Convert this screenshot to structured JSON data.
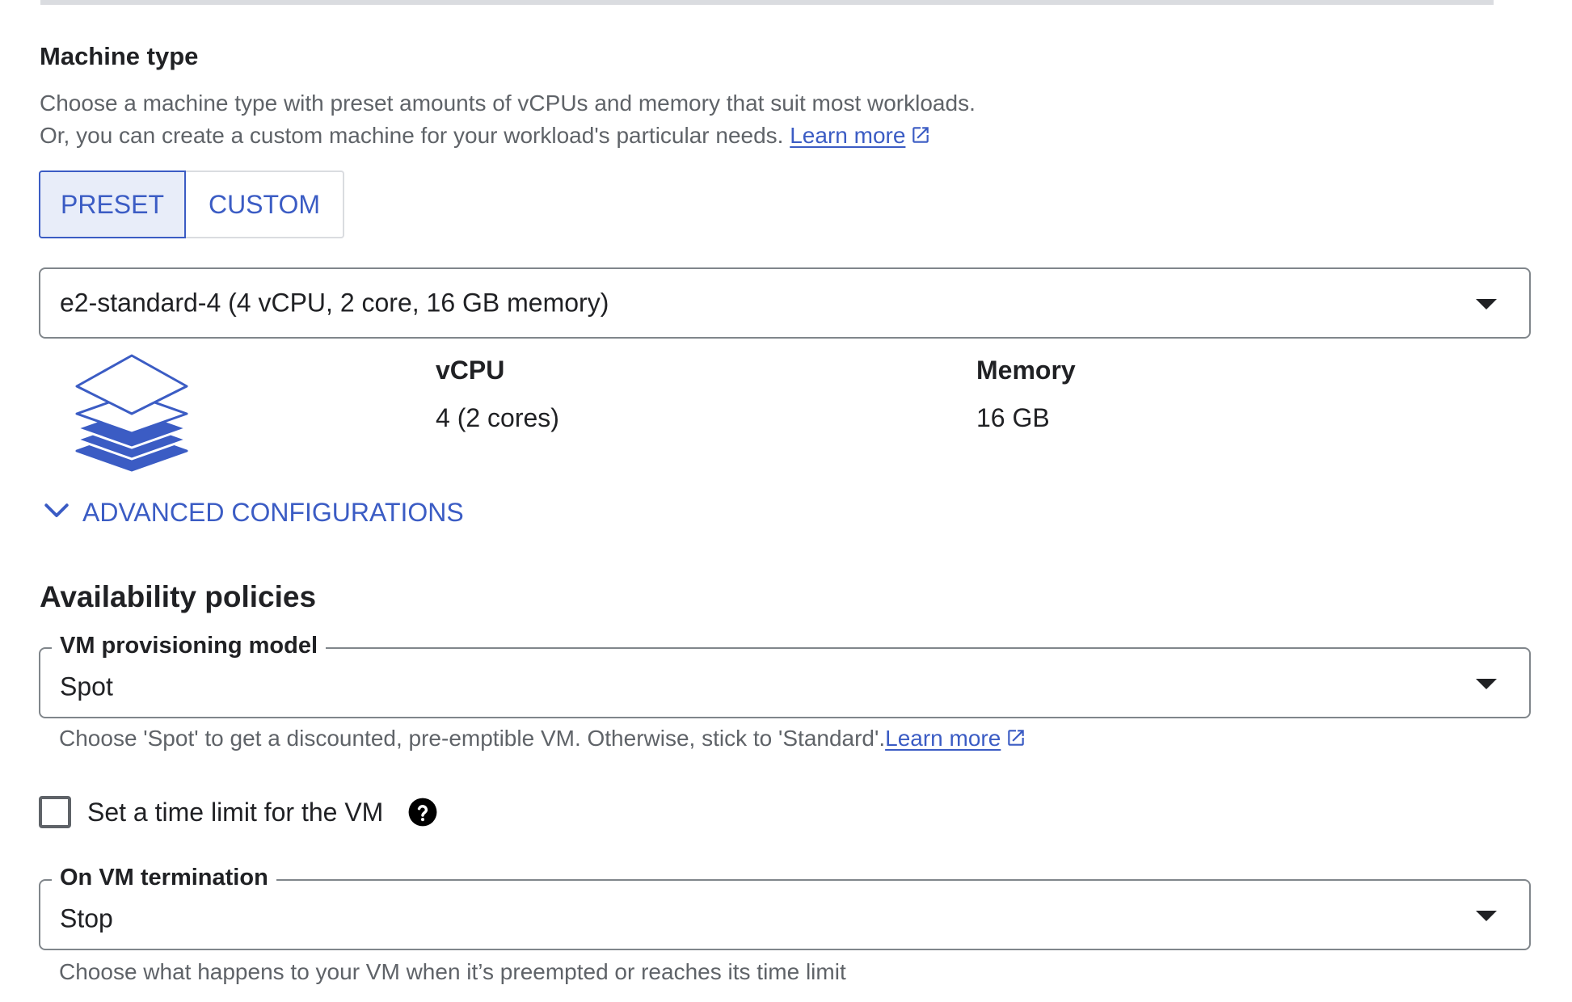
{
  "machine_type": {
    "title": "Machine type",
    "description_line1": "Choose a machine type with preset amounts of vCPUs and memory that suit most workloads.",
    "description_line2": "Or, you can create a custom machine for your workload's particular needs.",
    "learn_more": "Learn more",
    "tabs": [
      {
        "label": "PRESET",
        "selected": true
      },
      {
        "label": "CUSTOM",
        "selected": false
      }
    ],
    "selected_machine": "e2-standard-4 (4 vCPU, 2 core, 16 GB memory)",
    "icon": "stacked-layers-icon",
    "vcpu_label": "vCPU",
    "vcpu_value": "4 (2 cores)",
    "memory_label": "Memory",
    "memory_value": "16 GB",
    "advanced_label": "ADVANCED CONFIGURATIONS"
  },
  "availability": {
    "title": "Availability policies",
    "provisioning": {
      "label": "VM provisioning model",
      "value": "Spot",
      "helper": "Choose 'Spot' to get a discounted, pre-emptible VM. Otherwise, stick to 'Standard'.",
      "learn_more": "Learn more"
    },
    "time_limit": {
      "label": "Set a time limit for the VM",
      "checked": false
    },
    "termination": {
      "label": "On VM termination",
      "value": "Stop",
      "helper": "Choose what happens to your VM when it’s preempted or reaches its time limit"
    }
  },
  "colors": {
    "accent": "#3b5cc4",
    "accent_bg": "#e8edf9",
    "text": "#202124",
    "secondary_text": "#5f6368",
    "border": "#80868b"
  }
}
